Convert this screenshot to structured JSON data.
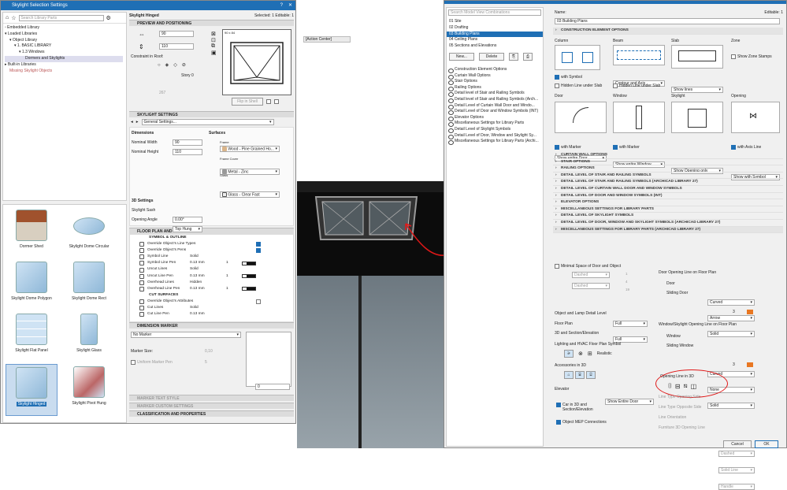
{
  "left_window": {
    "title": "Skylight Selection Settings",
    "search_placeholder": "Search Library Parts",
    "tree": [
      "Embedded Library",
      "Loaded Libraries",
      "Object Library",
      "1. BASIC LIBRARY",
      "1.3 Windows",
      "Dormers and Skylights",
      "Built-in Libraries",
      "Missing Skylight Objects"
    ],
    "object_name": "Skylight Hinged",
    "selected_info": "Selected: 1 Editable: 1",
    "preview_section": "PREVIEW AND POSITIONING",
    "width": "90",
    "height": "110",
    "constraint_label": "Constraint in Roof:",
    "story_label": "Story 0",
    "elev_value": "267",
    "preview_size": "90 x 84",
    "flip_label": "Flip in Shell",
    "skylight_section": "SKYLIGHT SETTINGS",
    "general_settings": "General Settings...",
    "dimensions_label": "Dimensions",
    "nominal_width_label": "Nominal Width",
    "nominal_width": "90",
    "nominal_height_label": "Nominal Height",
    "nominal_height": "110",
    "surfaces_label": "Surfaces",
    "frame_label": "Frame",
    "frame_value": "Wood - Pine Grained Ho...",
    "frame_cover_label": "Frame Cover",
    "frame_cover_value": "Metal - Zinc",
    "glass_label": "Glass",
    "glass_value": "Glass - Clear Fast",
    "settings3d_label": "3D Settings",
    "sash_label": "Skylight Sash",
    "sash_value": "Top Hung",
    "opening_angle_label": "Opening Angle",
    "opening_angle_value": "0.00°",
    "floorplan_section": "FLOOR PLAN AND SECTION",
    "symbol_outline": "SYMBOL & OUTLINE",
    "symbol_rows": [
      [
        "Override Object's Line Types",
        ""
      ],
      [
        "Override Object's Pens",
        ""
      ],
      [
        "Symbol Line",
        "Solid"
      ],
      [
        "Symbol Line Pen",
        "0.13 mm"
      ],
      [
        "Uncut Lines",
        "Solid"
      ],
      [
        "Uncut Line Pen",
        "0.13 mm"
      ],
      [
        "Overhead Lines",
        "Hidden"
      ],
      [
        "Overhead Line Pen",
        "0.13 mm"
      ]
    ],
    "pen_num": "1",
    "cut_surfaces": "CUT SURFACES",
    "cut_rows": [
      [
        "Override Object's Attributes",
        ""
      ],
      [
        "Cut Lines",
        "Solid"
      ],
      [
        "Cut Line Pen",
        "0.13 mm"
      ]
    ],
    "dimension_section": "DIMENSION MARKER",
    "no_marker": "No Marker",
    "marker_size_label": "Marker Size:",
    "marker_size_value": "0,10",
    "uniform_pen_label": "Uniform Marker Pen",
    "uniform_pen_value": "5",
    "marker_angle": "0",
    "marker_text_section": "MARKER TEXT STYLE",
    "marker_custom_section": "MARKER CUSTOM SETTINGS",
    "classification_section": "CLASSIFICATION AND PROPERTIES",
    "tiles": [
      "Dormer Shed",
      "Skylight Dome Circular",
      "Skylight Dome Polygon",
      "Skylight Dome Rect",
      "Skylight Flat Panel",
      "Skylight Glass",
      "Skylight Hinged",
      "Skylight Pivot Hung"
    ]
  },
  "action_center": "[Action Center]",
  "right_window": {
    "search_placeholder": "Search Model View Combinations",
    "combos": [
      "01 Site",
      "02 Drafting",
      "03 Building Plans",
      "04 Ceiling Plans",
      "05 Sections and Elevations"
    ],
    "new_btn": "New...",
    "delete_btn": "Delete",
    "options": [
      "Construction Element Options",
      "Curtain Wall Options",
      "Stair Options",
      "Railing Options",
      "Detail level of Stair and Railing Symbols",
      "Detail level of Stair and Railing Symbols (Arch...",
      "Detail Level of Curtain Wall Door and Windo...",
      "Detail Level of Door and Window Symbols (INT)",
      "Elevator Options",
      "Miscellaneous Settings for Library Parts",
      "Detail Level of Skylight Symbols",
      "Detail Level of Door, Window and Skylight Sy...",
      "Miscellaneous Settings for Library Parts (Archi..."
    ],
    "name_label": "Name:",
    "name_value": "03 Building Plans",
    "editable": "Editable: 1",
    "construction_section": "CONSTRUCTION ELEMENT OPTIONS",
    "col_labels": [
      "Column",
      "Beam",
      "Slab",
      "Zone"
    ],
    "with_symbol": "with Symbol",
    "hidden_line_slab": "Hidden Line under Slab",
    "beam_dd": "Contour and Axis",
    "slab_dd": "Show lines",
    "show_zone_stamps": "Show Zone Stamps",
    "row2_labels": [
      "Door",
      "Window",
      "Skylight",
      "Opening"
    ],
    "door_dd": "Show entire Door",
    "window_dd": "Show entire Window",
    "skylight_dd": "Show Opening only",
    "opening_dd": "Show with Symbol",
    "with_marker": "with Marker",
    "with_axis_line": "with Axis Line",
    "collapsed_sections": [
      "CURTAIN WALL OPTIONS",
      "STAIR OPTIONS",
      "RAILING OPTIONS",
      "DETAIL LEVEL OF STAIR AND RAILING SYMBOLS",
      "DETAIL LEVEL OF STAIR AND RAILING SYMBOLS (ARCHICAD LIBRARY 27)",
      "DETAIL LEVEL OF CURTAIN WALL DOOR AND WINDOW SYMBOLS",
      "DETAIL LEVEL OF DOOR AND WINDOW SYMBOLS (INT)",
      "ELEVATOR OPTIONS",
      "MISCELLANEOUS SETTINGS FOR LIBRARY PARTS",
      "DETAIL LEVEL OF SKYLIGHT SYMBOLS",
      "DETAIL LEVEL OF DOOR, WINDOW AND SKYLIGHT SYMBOLS (ARCHICAD LIBRARY 27)"
    ],
    "misc_section": "MISCELLANEOUS SETTINGS FOR LIBRARY PARTS (ARCHICAD LIBRARY 27)",
    "minimal_space": "Minimal Space of Door and Object",
    "dashed": "Dashed",
    "door_opening_line": "Door Opening Line on Floor Plan",
    "door_label": "Door",
    "door_value": "Curved",
    "sliding_door_label": "Sliding Door",
    "sliding_door_value": "Arrow",
    "solid": "Solid",
    "pen3": "3",
    "detail_level_label": "Object and Lamp Detail Level",
    "floor_plan_label": "Floor Plan",
    "floor_plan_value": "Full",
    "section_label": "3D and Section/Elevation",
    "section_value": "Full",
    "hvac_label": "Lighting and HVAC Floor Plan Symbol",
    "realistic": "Realistic",
    "ws_opening_line": "Window/Skylight Opening Line on Floor Plan",
    "window_label": "Window",
    "window_value": "Curved",
    "sliding_window_label": "Sliding Window",
    "sliding_window_value": "None",
    "accessories_label": "Accessories in 3D",
    "opening_line_3d": "Opening Line in 3D",
    "elevator_label": "Elevator",
    "elevator_value": "Show Entire Door",
    "car_label": "Car in 3D and Section/Elevation",
    "mep_label": "Object MEP Connections",
    "line_type_opening": "Line Type Opening Side",
    "line_type_opening_value": "Dashed",
    "line_type_opposite": "Line Type Opposite Side",
    "line_type_opposite_value": "Solid Line",
    "line_orientation": "Line Orientation",
    "line_orientation_value": "Handle",
    "furniture_label": "Furniture 3D Opening Line",
    "cancel_btn": "Cancel",
    "ok_btn": "OK",
    "small_nums": [
      "1",
      "1",
      "4",
      "19"
    ]
  },
  "colors": {
    "accent": "#1f6fb5",
    "annotation": "#e01818",
    "pen_orange": "#e87722"
  }
}
